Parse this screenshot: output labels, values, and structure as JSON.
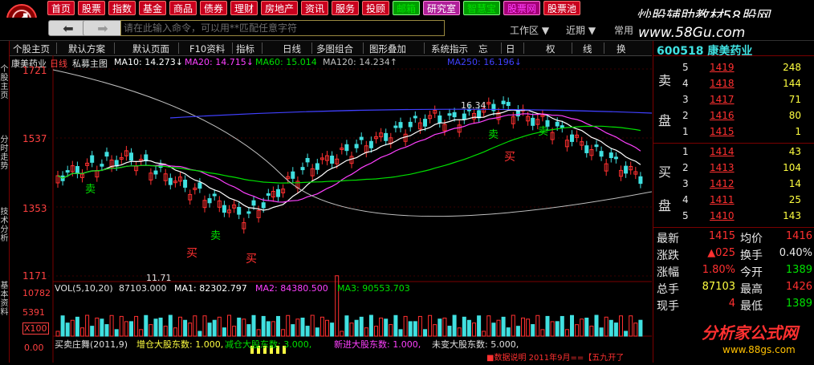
{
  "menu": {
    "items": [
      {
        "label": "首页",
        "style": ""
      },
      {
        "label": "股票",
        "style": ""
      },
      {
        "label": "指数",
        "style": ""
      },
      {
        "label": "基金",
        "style": ""
      },
      {
        "label": "商品",
        "style": ""
      },
      {
        "label": "债券",
        "style": ""
      },
      {
        "label": "理财",
        "style": ""
      },
      {
        "label": "房地产",
        "style": ""
      },
      {
        "label": "资讯",
        "style": ""
      },
      {
        "label": "服务",
        "style": ""
      },
      {
        "label": "投顾",
        "style": ""
      },
      {
        "label": "邮箱",
        "style": "green"
      },
      {
        "label": "研究室",
        "style": "purple"
      },
      {
        "label": "智慧宝",
        "style": "green"
      },
      {
        "label": "股票网",
        "style": "magenta"
      },
      {
        "label": "股票池",
        "style": ""
      }
    ],
    "watermark_top": "炒股辅助教材58股网",
    "watermark_url": "www.58Gu.com"
  },
  "bar2": {
    "back_icon": "back-arrow-icon",
    "forward_icon": "forward-arrow-icon",
    "command_placeholder": "请在此输入命令，可以用**匹配任意字符",
    "workspace": "工作区 ▼",
    "recent": "近期 ▼",
    "common": "常用"
  },
  "toolbar": {
    "items": [
      "个股主页",
      "默认方案",
      "默认页面",
      "F10资料",
      "指标",
      "日线",
      "多图组合",
      "图形叠加",
      "系统指示",
      "忘",
      "日",
      "权",
      "线",
      "换"
    ]
  },
  "left_tabs": [
    "个股主页",
    "分时走势",
    "技术分析",
    "基本资料"
  ],
  "chart": {
    "stock_name": "康美药业",
    "period": "日线",
    "indicator_title": "私募主图",
    "ma": [
      {
        "name": "MA10",
        "value": "14.273",
        "arrow": "↓",
        "color": "#ffffff"
      },
      {
        "name": "MA20",
        "value": "14.715",
        "arrow": "↓",
        "color": "#ff40ff"
      },
      {
        "name": "MA60",
        "value": "15.014",
        "arrow": "",
        "color": "#00e000"
      },
      {
        "name": "MA120",
        "value": "14.234",
        "arrow": "↑",
        "color": "#c0c0c0"
      },
      {
        "name": "MA250",
        "value": "16.196",
        "arrow": "↓",
        "color": "#4040ff"
      }
    ],
    "y_labels": [
      "1721",
      "1537",
      "1353",
      "1171"
    ],
    "high_label": "16.34",
    "low_label": "11.71",
    "signals": [
      {
        "text": "卖",
        "color": "#00e000"
      },
      {
        "text": "卖",
        "color": "#00e000"
      },
      {
        "text": "买",
        "color": "#ff3030"
      },
      {
        "text": "买",
        "color": "#ff3030"
      },
      {
        "text": "卖",
        "color": "#00e000"
      },
      {
        "text": "卖",
        "color": "#00e000"
      },
      {
        "text": "买",
        "color": "#ff3030"
      }
    ]
  },
  "volume": {
    "title": "VOL(5,10,20)",
    "vol": "87103.000",
    "ma1": "MA1: 82302.797",
    "ma2": "MA2: 84380.500",
    "ma3": "MA3: 90553.703",
    "y_labels": [
      "10782",
      "5391",
      "X100"
    ]
  },
  "bottom_panel": {
    "title": "买卖庄舞(2011,9)",
    "c1": "增仓大股东数: 1.000,",
    "c2": "减仓大股东数: 3.000,",
    "c3": "新进大股东数: 1.000,",
    "c4": "未变大股东数: 5.000,",
    "y_label": "0.00",
    "tail": "■数据说明 2011年9月==【五九开了",
    "watermark_logo": "分析家公式网",
    "watermark_url": "www.88gs.com"
  },
  "quote": {
    "code_name": "600518 康美药业",
    "sell": [
      {
        "lvl": "5",
        "price": "1419",
        "vol": "248"
      },
      {
        "lvl": "4",
        "price": "1418",
        "vol": "144"
      },
      {
        "lvl": "3",
        "price": "1417",
        "vol": "71"
      },
      {
        "lvl": "2",
        "price": "1416",
        "vol": "80"
      },
      {
        "lvl": "1",
        "price": "1415",
        "vol": "1"
      }
    ],
    "buy": [
      {
        "lvl": "1",
        "price": "1414",
        "vol": "43"
      },
      {
        "lvl": "2",
        "price": "1413",
        "vol": "104"
      },
      {
        "lvl": "3",
        "price": "1412",
        "vol": "14"
      },
      {
        "lvl": "4",
        "price": "1411",
        "vol": "25"
      },
      {
        "lvl": "5",
        "price": "1410",
        "vol": "143"
      }
    ],
    "sell_label": [
      "卖",
      "盘"
    ],
    "buy_label": [
      "买",
      "盘"
    ],
    "stats": [
      {
        "k": "最新",
        "v": "1415",
        "k2": "均价",
        "v2": "1416"
      },
      {
        "k": "涨跌",
        "v": "▲025",
        "k2": "换手",
        "v2": "0.40%"
      },
      {
        "k": "涨幅",
        "v": "1.80%",
        "k2": "今开",
        "v2": "1389"
      },
      {
        "k": "总手",
        "v": "87103",
        "k2": "最高",
        "v2": "1426"
      },
      {
        "k": "现手",
        "v": "4",
        "k2": "最低",
        "v2": "1389"
      }
    ]
  }
}
